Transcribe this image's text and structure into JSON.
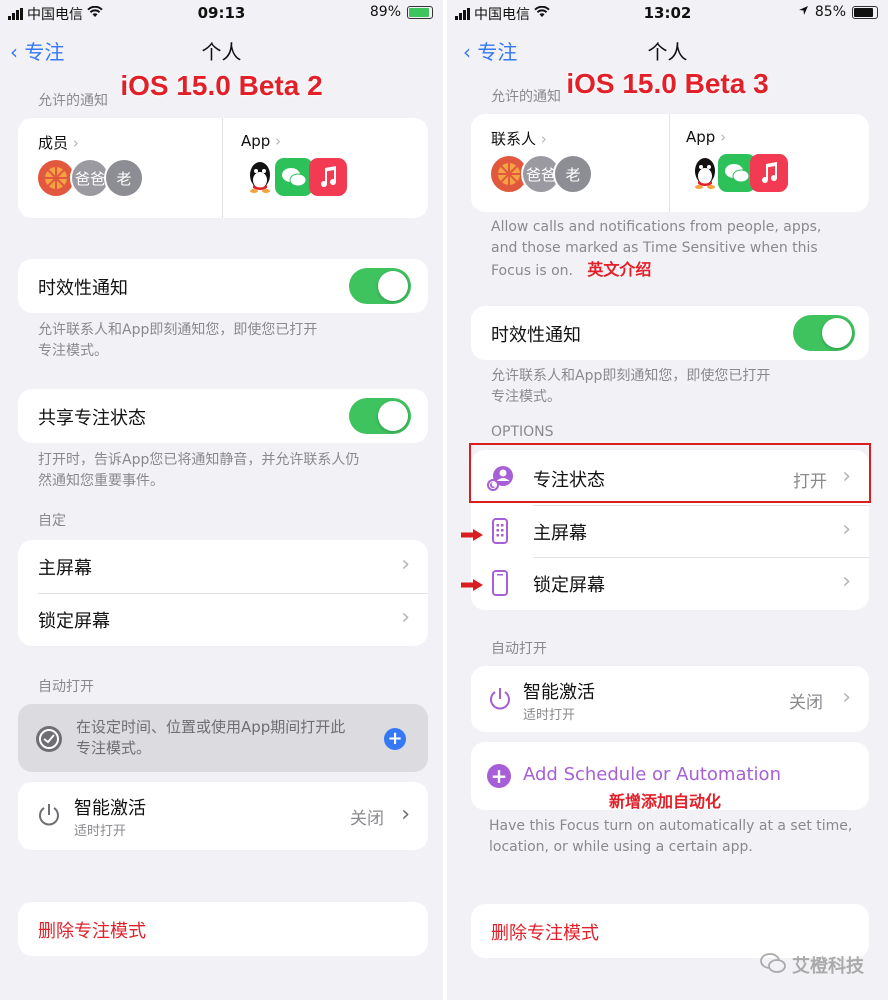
{
  "left": {
    "status": {
      "carrier": "中国电信",
      "time": "09:13",
      "battery": "89%"
    },
    "nav": {
      "back": "专注",
      "title": "个人"
    },
    "overlay_title": "iOS 15.0 Beta 2",
    "allowed_header": "允许的通知",
    "people_label": "成员",
    "avatar_texts": [
      "爸爸",
      "老"
    ],
    "apps_label": "App",
    "time_sensitive": {
      "label": "时效性通知",
      "help_line1": "允许联系人和App即刻通知您，即使您已打开",
      "help_line2": "专注模式。"
    },
    "share_status": {
      "label": "共享专注状态",
      "help_line1": "打开时，告诉App您已将通知静音，并允许联系人仍",
      "help_line2": "然通知您重要事件。"
    },
    "customize_header": "自定",
    "home_screen": "主屏幕",
    "lock_screen": "锁定屏幕",
    "auto_header": "自动打开",
    "schedule": {
      "line1": "在设定时间、位置或使用App期间打开此",
      "line2": "专注模式。"
    },
    "smart": {
      "title": "智能激活",
      "sub": "适时打开",
      "value": "关闭"
    },
    "delete": "删除专注模式"
  },
  "right": {
    "status": {
      "carrier": "中国电信",
      "time": "13:02",
      "battery": "85%"
    },
    "nav": {
      "back": "专注",
      "title": "个人"
    },
    "overlay_title": "iOS 15.0 Beta 3",
    "allowed_header": "允许的通知",
    "people_label": "联系人",
    "avatar_texts": [
      "爸爸",
      "老"
    ],
    "apps_label": "App",
    "allow_help": {
      "line1": "Allow calls and notifications from people, apps,",
      "line2": "and those marked as Time Sensitive when this",
      "line3": "Focus is on."
    },
    "annotation_english": "英文介绍",
    "time_sensitive": {
      "label": "时效性通知",
      "help_line1": "允许联系人和App即刻通知您，即使您已打开",
      "help_line2": "专注模式。"
    },
    "options_header": "OPTIONS",
    "focus_status": {
      "label": "专注状态",
      "value": "打开"
    },
    "home_screen": "主屏幕",
    "lock_screen": "锁定屏幕",
    "auto_header": "自动打开",
    "smart": {
      "title": "智能激活",
      "sub": "适时打开",
      "value": "关闭"
    },
    "add_schedule": "Add Schedule or Automation",
    "annotation_add": "新增添加自动化",
    "auto_help": {
      "line1": "Have this Focus turn on automatically at a set time,",
      "line2": "location, or while using a certain app."
    },
    "delete": "删除专注模式"
  },
  "watermark": "艾橙科技",
  "colors": {
    "accent": "#3478f6",
    "toggle_on": "#3fc35f",
    "destructive": "#e2202a",
    "focus_purple": "#a65fd6",
    "annotation_red": "#d81e1e"
  }
}
